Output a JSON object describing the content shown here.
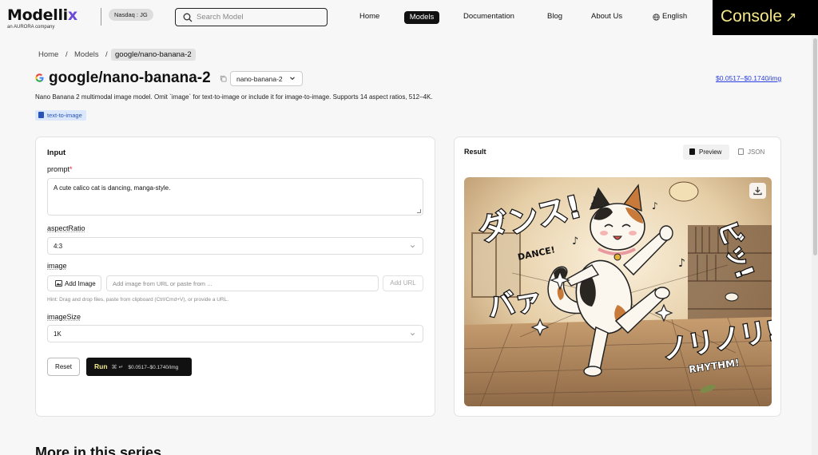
{
  "header": {
    "logo_text": "Modellix",
    "logo_sub": "an AURORA company",
    "badge": "Nasdaq : JG",
    "search_placeholder": "Search Model",
    "nav": {
      "home": "Home",
      "models": "Models",
      "documentation": "Documentation",
      "blog": "Blog",
      "about": "About Us",
      "language": "English"
    },
    "console_label": "Console",
    "console_arrow": "↗"
  },
  "breadcrumb": {
    "home": "Home",
    "sep": "/",
    "models": "Models",
    "current": "google/nano-banana-2"
  },
  "model": {
    "title": "google/nano-banana-2",
    "variant": "nano-banana-2",
    "price": "$0.0517–$0.1740/img",
    "description": "Nano Banana 2 multimodal image model. Omit `image` for text-to-image or include it for image-to-image. Supports 14 aspect ratios, 512–4K.",
    "tag": "text-to-image"
  },
  "input": {
    "heading": "Input",
    "prompt_label": "prompt",
    "required_mark": "*",
    "prompt_value": "A cute calico cat is dancing, manga-style.",
    "aspect_label": "aspectRatio",
    "aspect_value": "4:3",
    "image_label": "image",
    "add_image": "Add Image",
    "url_placeholder": "Add image from URL or paste from ...",
    "add_url": "Add URL",
    "hint": "Hint: Drag and drop files, paste from clipboard (Ctrl/Cmd+V), or provide a URL.",
    "size_label": "imageSize",
    "size_value": "1K",
    "reset": "Reset",
    "run": "Run",
    "run_keys": "⌘ ↵",
    "run_price": "$0.0517–$0.1740/img"
  },
  "result": {
    "heading": "Result",
    "tab_preview": "Preview",
    "tab_json": "JSON",
    "image_text": {
      "dance_kana": "ダンス!",
      "dance": "DANCE!",
      "rhythm_kana": "ノリノリ!",
      "rhythm": "RHYTHM!",
      "bi": "ビッ!",
      "ba": "バァ"
    }
  },
  "footer": {
    "series_title": "More in this series"
  },
  "colors": {
    "accent": "#6b4bd8",
    "console_text": "#f5e88a",
    "link": "#2b3fe0",
    "tag_bg": "#dbe8fb"
  }
}
